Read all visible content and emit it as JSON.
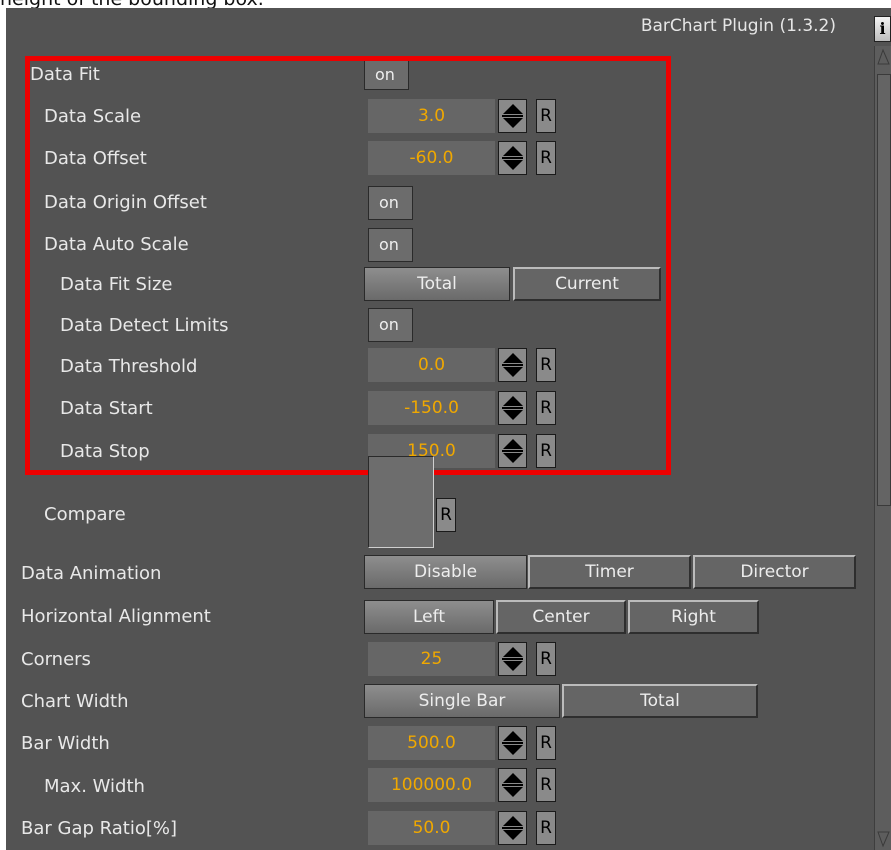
{
  "caption": "height of the bounding box.",
  "plugin_title": "BarChart Plugin (1.3.2)",
  "info_label": "i",
  "spin_reset": "R",
  "rows": {
    "data_fit": {
      "label": "Data Fit",
      "toggle": "on"
    },
    "data_scale": {
      "label": "Data Scale",
      "value": "3.0"
    },
    "data_offset": {
      "label": "Data Offset",
      "value": "-60.0"
    },
    "data_origin_offset": {
      "label": "Data Origin Offset",
      "toggle": "on"
    },
    "data_auto_scale": {
      "label": "Data Auto Scale",
      "toggle": "on"
    },
    "data_fit_size": {
      "label": "Data Fit Size",
      "options": [
        "Total",
        "Current"
      ],
      "selected": "Total"
    },
    "data_detect_limits": {
      "label": "Data Detect Limits",
      "toggle": "on"
    },
    "data_threshold": {
      "label": "Data Threshold",
      "value": "0.0"
    },
    "data_start": {
      "label": "Data Start",
      "value": "-150.0"
    },
    "data_stop": {
      "label": "Data Stop",
      "value": "150.0"
    },
    "compare": {
      "label": "Compare"
    },
    "data_animation": {
      "label": "Data Animation",
      "options": [
        "Disable",
        "Timer",
        "Director"
      ],
      "selected": "Disable"
    },
    "horizontal_alignment": {
      "label": "Horizontal Alignment",
      "options": [
        "Left",
        "Center",
        "Right"
      ],
      "selected": "Left"
    },
    "corners": {
      "label": "Corners",
      "value": "25"
    },
    "chart_width": {
      "label": "Chart Width",
      "options": [
        "Single Bar",
        "Total"
      ],
      "selected": "Single Bar"
    },
    "bar_width": {
      "label": "Bar Width",
      "value": "500.0"
    },
    "max_width": {
      "label": "Max. Width",
      "value": "100000.0"
    },
    "bar_gap_ratio": {
      "label": "Bar Gap Ratio[%]",
      "value": "50.0"
    }
  },
  "colors": {
    "panel_bg": "#535353",
    "value_text": "#f0a800",
    "highlight": "#ee0000"
  }
}
